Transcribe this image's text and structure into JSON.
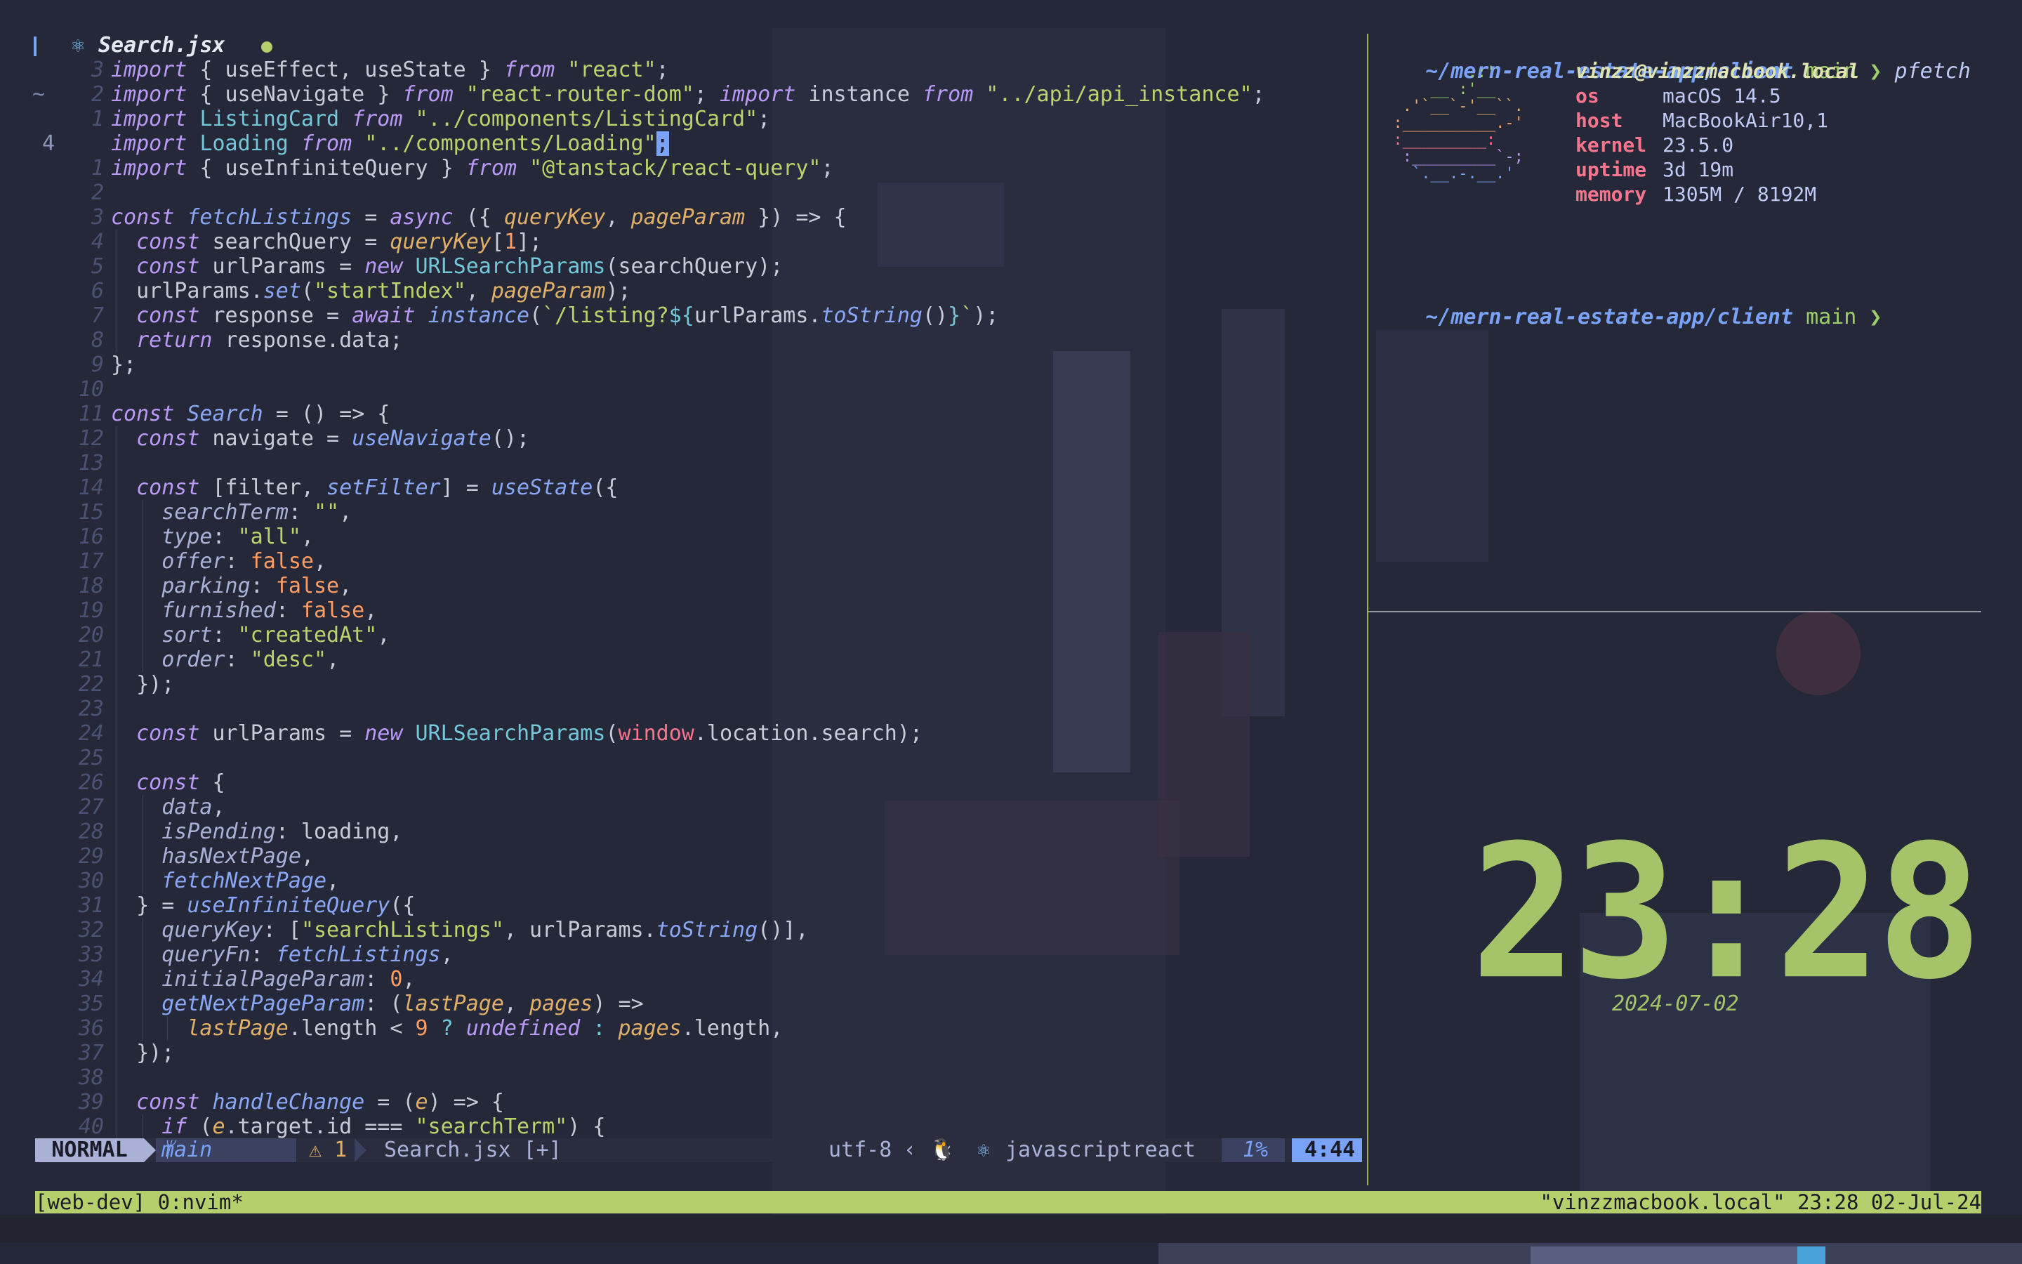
{
  "editor": {
    "tab": {
      "filename": "Search.jsx",
      "icon": "react-icon",
      "modified_dot_color": "#b4cf6b"
    },
    "lines": [
      {
        "n": "3",
        "sign": "",
        "indent": 0,
        "html": "<span class=\"k\">import</span> { useEffect, useState } <span class=\"k\">from</span> <span class=\"s\">\"react\"</span>;"
      },
      {
        "n": "2",
        "sign": "~",
        "indent": 0,
        "html": "<span class=\"k\">import</span> { useNavigate } <span class=\"k\">from</span> <span class=\"s\">\"react-router-dom\"</span>; <span class=\"k\">import</span> instance <span class=\"k\">from</span> <span class=\"s\">\"../api/api_instance\"</span>;"
      },
      {
        "n": "1",
        "sign": "",
        "indent": 0,
        "html": "<span class=\"k\">import</span> <span class=\"t\">ListingCard</span> <span class=\"k\">from</span> <span class=\"s\">\"../components/ListingCard\"</span>;"
      },
      {
        "n": "4",
        "sign": "",
        "indent": 0,
        "cur": true,
        "html": "<span class=\"k\">import</span> <span class=\"t\">Loading</span> <span class=\"k\">from</span> <span class=\"s\">\"../components/Loading\"</span><span class=\"cursor\">;</span>"
      },
      {
        "n": "1",
        "sign": "",
        "indent": 0,
        "html": "<span class=\"k\">import</span> { useInfiniteQuery } <span class=\"k\">from</span> <span class=\"s\">\"@tanstack/react-query\"</span>;"
      },
      {
        "n": "2",
        "sign": "",
        "indent": 0,
        "html": ""
      },
      {
        "n": "3",
        "sign": "",
        "indent": 0,
        "html": "<span class=\"k\">const</span> <span class=\"f\">fetchListings</span> = <span class=\"k\">async</span> ({ <span class=\"p\">queryKey</span>, <span class=\"p\">pageParam</span> }) =&gt; {"
      },
      {
        "n": "4",
        "sign": "",
        "indent": 1,
        "html": "  <span class=\"k\">const</span> searchQuery = <span class=\"p\">queryKey</span>[<span class=\"b\">1</span>];"
      },
      {
        "n": "5",
        "sign": "",
        "indent": 1,
        "html": "  <span class=\"k\">const</span> urlParams = <span class=\"k\">new</span> <span class=\"t\">URLSearchParams</span>(searchQuery);"
      },
      {
        "n": "6",
        "sign": "",
        "indent": 1,
        "html": "  urlParams.<span class=\"f\">set</span>(<span class=\"s\">\"startIndex\"</span>, <span class=\"p\">pageParam</span>);"
      },
      {
        "n": "7",
        "sign": "",
        "indent": 1,
        "html": "  <span class=\"k\">const</span> response = <span class=\"k\">await</span> <span class=\"f\">instance</span>(<span class=\"s\">`/listing?</span><span class=\"t\">${</span>urlParams.<span class=\"f\">toString</span>()<span class=\"t\">}</span><span class=\"s\">`</span>);"
      },
      {
        "n": "8",
        "sign": "",
        "indent": 1,
        "html": "  <span class=\"k\">return</span> response.data;"
      },
      {
        "n": "9",
        "sign": "",
        "indent": 0,
        "html": "};"
      },
      {
        "n": "10",
        "sign": "",
        "indent": 0,
        "html": ""
      },
      {
        "n": "11",
        "sign": "",
        "indent": 0,
        "html": "<span class=\"k\">const</span> <span class=\"f\">Search</span> = () =&gt; {"
      },
      {
        "n": "12",
        "sign": "",
        "indent": 1,
        "html": "  <span class=\"k\">const</span> navigate = <span class=\"f\">useNavigate</span>();"
      },
      {
        "n": "13",
        "sign": "",
        "indent": 1,
        "html": ""
      },
      {
        "n": "14",
        "sign": "",
        "indent": 1,
        "html": "  <span class=\"k\">const</span> [filter, <span class=\"f\">setFilter</span>] = <span class=\"f\">useState</span>({"
      },
      {
        "n": "15",
        "sign": "",
        "indent": 2,
        "html": "    <span class=\"pr\">searchTerm</span>: <span class=\"s\">\"\"</span>,"
      },
      {
        "n": "16",
        "sign": "",
        "indent": 2,
        "html": "    <span class=\"pr\">type</span>: <span class=\"s\">\"all\"</span>,"
      },
      {
        "n": "17",
        "sign": "",
        "indent": 2,
        "html": "    <span class=\"pr\">offer</span>: <span class=\"b\">false</span>,"
      },
      {
        "n": "18",
        "sign": "",
        "indent": 2,
        "html": "    <span class=\"pr\">parking</span>: <span class=\"b\">false</span>,"
      },
      {
        "n": "19",
        "sign": "",
        "indent": 2,
        "html": "    <span class=\"pr\">furnished</span>: <span class=\"b\">false</span>,"
      },
      {
        "n": "20",
        "sign": "",
        "indent": 2,
        "html": "    <span class=\"pr\">sort</span>: <span class=\"s\">\"createdAt\"</span>,"
      },
      {
        "n": "21",
        "sign": "",
        "indent": 2,
        "html": "    <span class=\"pr\">order</span>: <span class=\"s\">\"desc\"</span>,"
      },
      {
        "n": "22",
        "sign": "",
        "indent": 1,
        "html": "  });"
      },
      {
        "n": "23",
        "sign": "",
        "indent": 1,
        "html": ""
      },
      {
        "n": "24",
        "sign": "",
        "indent": 1,
        "html": "  <span class=\"k\">const</span> urlParams = <span class=\"k\">new</span> <span class=\"t\">URLSearchParams</span>(<span class=\"r\">window</span>.location.search);"
      },
      {
        "n": "25",
        "sign": "",
        "indent": 1,
        "html": ""
      },
      {
        "n": "26",
        "sign": "",
        "indent": 1,
        "html": "  <span class=\"k\">const</span> {"
      },
      {
        "n": "27",
        "sign": "",
        "indent": 2,
        "html": "    <span class=\"pr\">data</span>,"
      },
      {
        "n": "28",
        "sign": "",
        "indent": 2,
        "html": "    <span class=\"pr\">isPending</span>: loading,"
      },
      {
        "n": "29",
        "sign": "",
        "indent": 2,
        "html": "    <span class=\"pr\">hasNextPage</span>,"
      },
      {
        "n": "30",
        "sign": "",
        "indent": 2,
        "html": "    <span class=\"f\">fetchNextPage</span>,"
      },
      {
        "n": "31",
        "sign": "",
        "indent": 1,
        "html": "  } = <span class=\"f\">useInfiniteQuery</span>({"
      },
      {
        "n": "32",
        "sign": "",
        "indent": 2,
        "html": "    <span class=\"pr\">queryKey</span>: [<span class=\"s\">\"searchListings\"</span>, urlParams.<span class=\"f\">toString</span>()],"
      },
      {
        "n": "33",
        "sign": "",
        "indent": 2,
        "html": "    <span class=\"pr\">queryFn</span>: <span class=\"f\">fetchListings</span>,"
      },
      {
        "n": "34",
        "sign": "",
        "indent": 2,
        "html": "    <span class=\"pr\">initialPageParam</span>: <span class=\"b\">0</span>,"
      },
      {
        "n": "35",
        "sign": "",
        "indent": 2,
        "html": "    <span class=\"f\">getNextPageParam</span>: (<span class=\"p\">lastPage</span>, <span class=\"p\">pages</span>) =&gt;"
      },
      {
        "n": "36",
        "sign": "",
        "indent": 3,
        "html": "      <span class=\"p\">lastPage</span>.length &lt; <span class=\"b\">9</span> <span class=\"t\">?</span> <span class=\"k\">undefined</span> <span class=\"t\">:</span> <span class=\"p\">pages</span>.length,"
      },
      {
        "n": "37",
        "sign": "",
        "indent": 1,
        "html": "  });"
      },
      {
        "n": "38",
        "sign": "",
        "indent": 1,
        "html": ""
      },
      {
        "n": "39",
        "sign": "",
        "indent": 1,
        "html": "  <span class=\"k\">const</span> <span class=\"f\">handleChange</span> = (<span class=\"p\">e</span>) =&gt; {"
      },
      {
        "n": "40",
        "sign": "",
        "indent": 2,
        "html": "    <span class=\"k\">if</span> (<span class=\"p\">e</span>.target.id === <span class=\"s\">\"searchTerm\"</span>) {"
      }
    ]
  },
  "statusline": {
    "mode": "NORMAL",
    "branch": "main",
    "warnings": "⚠ 1",
    "file": "Search.jsx [+]",
    "encoding": "utf-8",
    "os_icon": "🐧",
    "filetype": "javascriptreact",
    "percent": "1%",
    "position": "4:44"
  },
  "terminal": {
    "prompt1_dir": "~/mern-real-estate-app/client",
    "prompt1_branch": "main",
    "prompt1_arrow": "❯",
    "prompt1_cmd": "pfetch",
    "prompt2_dir": "~/mern-real-estate-app/client",
    "prompt2_branch": "main",
    "prompt2_arrow": "❯",
    "pfetch": {
      "title": "vinzz@vinzzmacbook.local",
      "rows": [
        {
          "key": "os",
          "value": "macOS 14.5"
        },
        {
          "key": "host",
          "value": "MacBookAir10,1"
        },
        {
          "key": "kernel",
          "value": "23.5.0"
        },
        {
          "key": "uptime",
          "value": "3d 19m"
        },
        {
          "key": "memory",
          "value": "1305M / 8192M"
        }
      ]
    }
  },
  "clock": {
    "time": "23:28",
    "date": "2024-07-02",
    "color": "#a5c46a"
  },
  "tmux": {
    "left": "[web-dev] 0:nvim*",
    "right": "\"vinzzmacbook.local\" 23:28 02-Jul-24",
    "color": "#b4cf6b"
  }
}
